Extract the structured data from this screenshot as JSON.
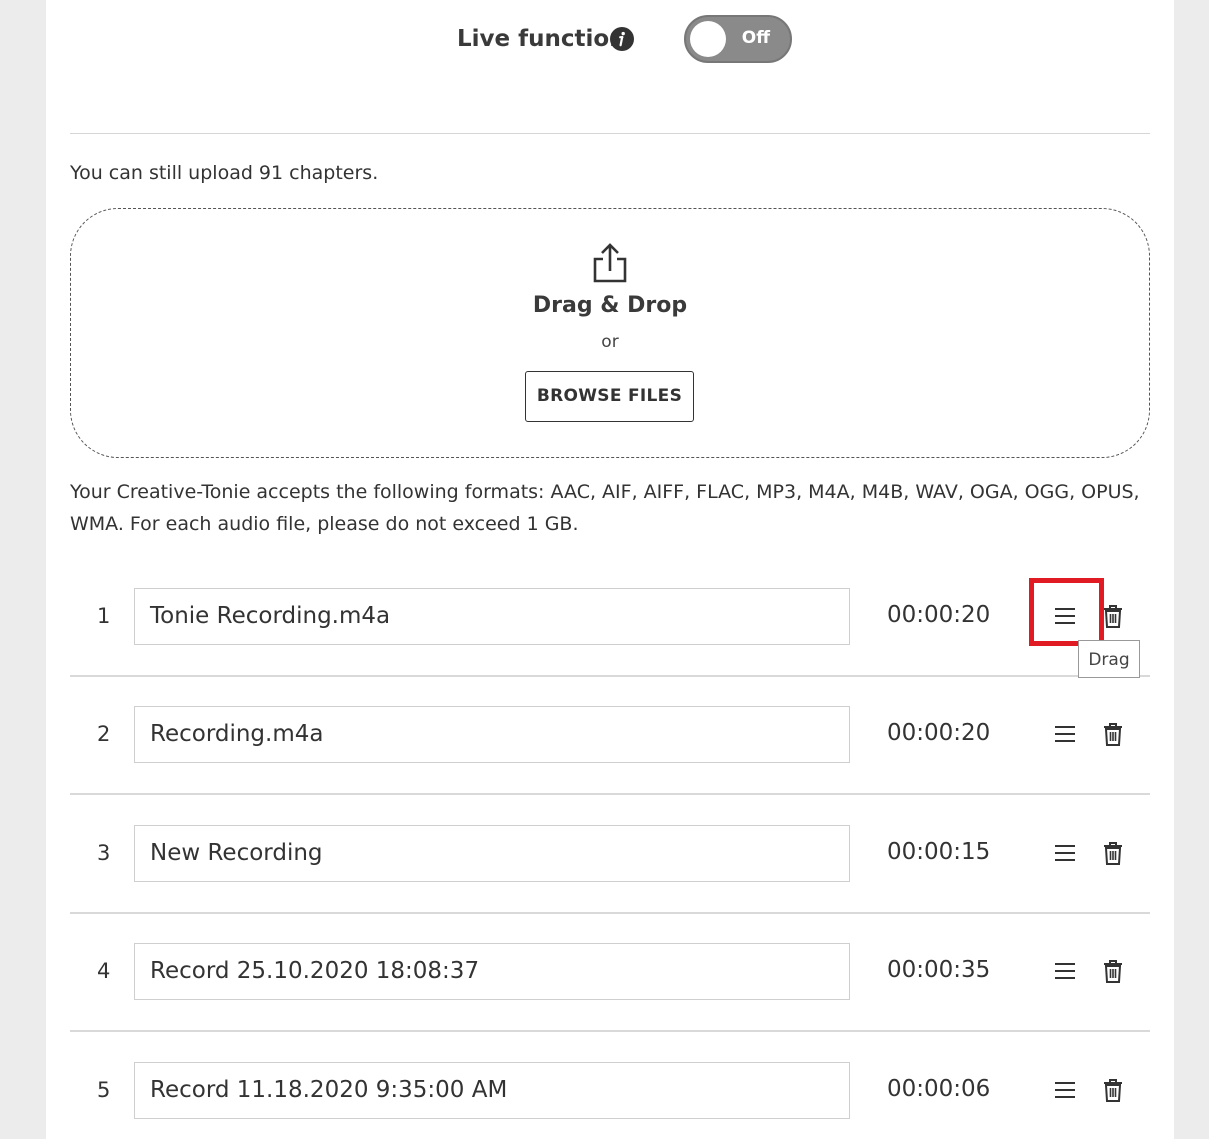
{
  "live": {
    "label": "Live function",
    "toggle_text": "Off",
    "toggle_state": "off"
  },
  "upload": {
    "remaining_note": "You can still upload 91 chapters.",
    "dropzone_title": "Drag & Drop",
    "or_text": "or",
    "browse_label": "BROWSE FILES",
    "formats_note": "Your Creative-Tonie accepts the following formats: AAC, AIF, AIFF, FLAC, MP3, M4A, M4B, WAV, OGA, OGG, OPUS, WMA. For each audio file, please do not exceed 1 GB."
  },
  "chapters": [
    {
      "num": "1",
      "name": "Tonie Recording.m4a",
      "duration": "00:00:20"
    },
    {
      "num": "2",
      "name": "Recording.m4a",
      "duration": "00:00:20"
    },
    {
      "num": "3",
      "name": "New Recording",
      "duration": "00:00:15"
    },
    {
      "num": "4",
      "name": "Record 25.10.2020 18:08:37",
      "duration": "00:00:35"
    },
    {
      "num": "5",
      "name": "Record 11.18.2020 9:35:00 AM",
      "duration": "00:00:06"
    }
  ],
  "tooltip": {
    "text": "Drag"
  },
  "colors": {
    "highlight": "#e01b24",
    "toggle_off": "#8a8a8a"
  }
}
